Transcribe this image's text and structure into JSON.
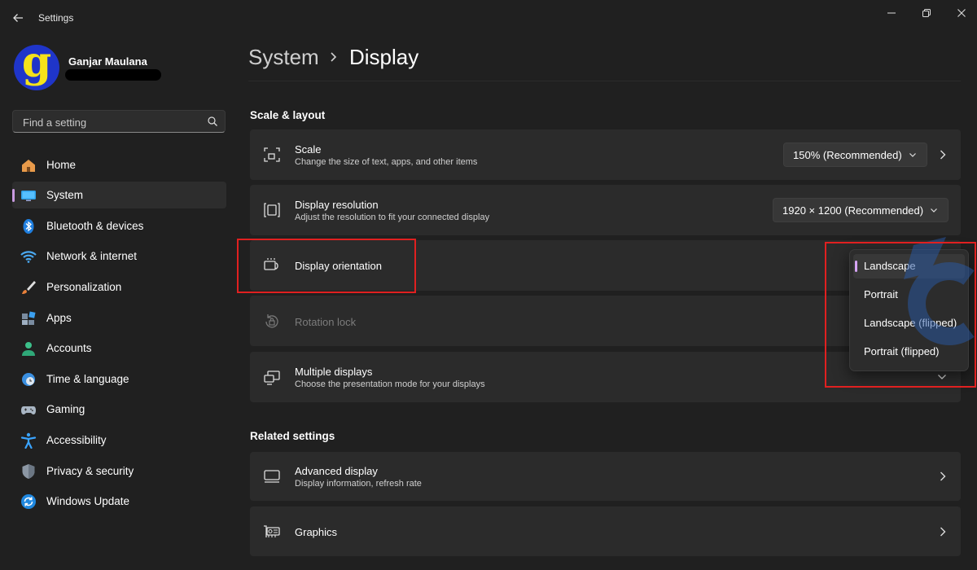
{
  "window": {
    "title": "Settings",
    "back_icon": "back-arrow-icon",
    "controls": [
      "minimize-icon",
      "restore-icon",
      "close-icon"
    ]
  },
  "user": {
    "avatar_letter": "g",
    "name": "Ganjar Maulana"
  },
  "search": {
    "placeholder": "Find a setting",
    "value": ""
  },
  "sidebar": {
    "items": [
      {
        "label": "Home",
        "icon": "home-icon"
      },
      {
        "label": "System",
        "icon": "system-icon",
        "active": true
      },
      {
        "label": "Bluetooth & devices",
        "icon": "bluetooth-icon"
      },
      {
        "label": "Network & internet",
        "icon": "wifi-icon"
      },
      {
        "label": "Personalization",
        "icon": "brush-icon"
      },
      {
        "label": "Apps",
        "icon": "apps-icon"
      },
      {
        "label": "Accounts",
        "icon": "accounts-icon"
      },
      {
        "label": "Time & language",
        "icon": "clock-globe-icon"
      },
      {
        "label": "Gaming",
        "icon": "gamepad-icon"
      },
      {
        "label": "Accessibility",
        "icon": "accessibility-icon"
      },
      {
        "label": "Privacy & security",
        "icon": "shield-icon"
      },
      {
        "label": "Windows Update",
        "icon": "update-icon"
      }
    ]
  },
  "breadcrumb": {
    "parent": "System",
    "current": "Display"
  },
  "scale_layout": {
    "heading": "Scale & layout",
    "scale": {
      "title": "Scale",
      "subtitle": "Change the size of text, apps, and other items",
      "value": "150% (Recommended)"
    },
    "resolution": {
      "title": "Display resolution",
      "subtitle": "Adjust the resolution to fit your connected display",
      "value": "1920 × 1200 (Recommended)"
    },
    "orientation": {
      "title": "Display orientation",
      "options": [
        "Landscape",
        "Portrait",
        "Landscape (flipped)",
        "Portrait (flipped)"
      ],
      "selected": "Landscape"
    },
    "rotation_lock": {
      "title": "Rotation lock",
      "enabled": false
    },
    "multiple_displays": {
      "title": "Multiple displays",
      "subtitle": "Choose the presentation mode for your displays"
    }
  },
  "related": {
    "heading": "Related settings",
    "advanced_display": {
      "title": "Advanced display",
      "subtitle": "Display information, refresh rate"
    },
    "graphics": {
      "title": "Graphics"
    }
  },
  "colors": {
    "background": "#202020",
    "card": "#2b2b2b",
    "accent": "#c99ae0",
    "annotation": "#e02020"
  }
}
